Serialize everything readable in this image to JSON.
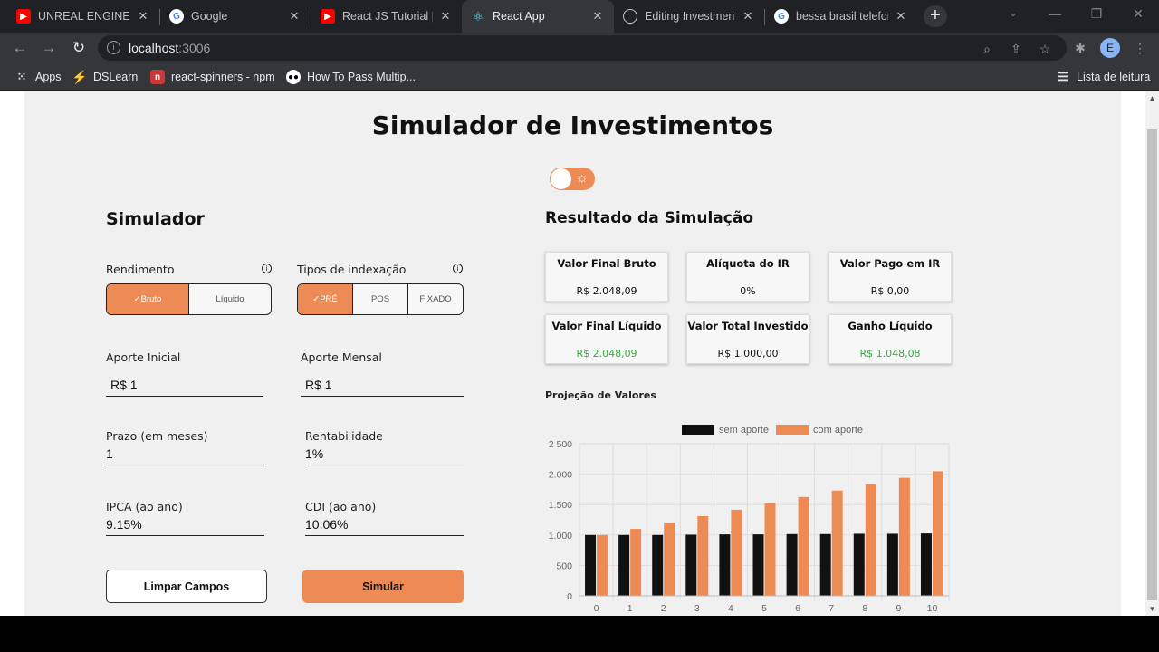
{
  "browser": {
    "tabs": [
      {
        "label": "UNREAL ENGINE (d",
        "icon": "youtube-icon"
      },
      {
        "label": "Google",
        "icon": "google-icon"
      },
      {
        "label": "React JS Tutorial | (",
        "icon": "youtube-icon"
      },
      {
        "label": "React App",
        "icon": "react-icon",
        "active": true
      },
      {
        "label": "Editing Investment",
        "icon": "github-icon"
      },
      {
        "label": "bessa brasil telefon",
        "icon": "google-icon"
      }
    ],
    "url_host": "localhost",
    "url_port": ":3006",
    "avatar_letter": "E",
    "bookmarks": [
      {
        "label": "Apps"
      },
      {
        "label": "DSLearn"
      },
      {
        "label": "react-spinners - npm"
      },
      {
        "label": "How To Pass Multip..."
      }
    ],
    "reading_list": "Lista de leitura"
  },
  "page": {
    "title": "Simulador de Investimentos",
    "accent": "#ee8b55",
    "simulator": {
      "title": "Simulador",
      "rendimento_label": "Rendimento",
      "rendimento_options": [
        "✓Bruto",
        "Líquido"
      ],
      "indexacao_label": "Tipos de indexação",
      "indexacao_options": [
        "✓PRÉ",
        "POS",
        "FIXADO"
      ],
      "aporte_inicial_label": "Aporte Inicial",
      "aporte_inicial_value": "R$ 1",
      "aporte_mensal_label": "Aporte Mensal",
      "aporte_mensal_value": "R$ 1",
      "prazo_label": "Prazo (em meses)",
      "prazo_value": "1",
      "rentabilidade_label": "Rentabilidade",
      "rentabilidade_value": "1%",
      "ipca_label": "IPCA (ao ano)",
      "ipca_value": "9.15%",
      "cdi_label": "CDI (ao ano)",
      "cdi_value": "10.06%",
      "clear_label": "Limpar Campos",
      "simulate_label": "Simular"
    },
    "result": {
      "title": "Resultado da Simulação",
      "cards": [
        {
          "title": "Valor Final Bruto",
          "value": "R$ 2.048,09",
          "green": false
        },
        {
          "title": "Alíquota do IR",
          "value": "0%",
          "green": false
        },
        {
          "title": "Valor Pago em IR",
          "value": "R$ 0,00",
          "green": false
        },
        {
          "title": "Valor Final Líquido",
          "value": "R$ 2.048,09",
          "green": true
        },
        {
          "title": "Valor Total Investido",
          "value": "R$ 1.000,00",
          "green": false
        },
        {
          "title": "Ganho Líquido",
          "value": "R$ 1.048,08",
          "green": true
        }
      ],
      "chart_title": "Projeção de Valores"
    }
  },
  "chart_data": {
    "type": "bar",
    "categories": [
      "0",
      "1",
      "2",
      "3",
      "4",
      "5",
      "6",
      "7",
      "8",
      "9",
      "10"
    ],
    "series": [
      {
        "name": "sem aporte",
        "color": "#111111",
        "values": [
          1000,
          1000,
          1000,
          1005,
          1010,
          1010,
          1015,
          1015,
          1020,
          1020,
          1025
        ]
      },
      {
        "name": "com aporte",
        "color": "#ee8b55",
        "values": [
          1000,
          1100,
          1205,
          1310,
          1415,
          1520,
          1625,
          1730,
          1835,
          1940,
          2048
        ]
      }
    ],
    "ylim": [
      0,
      2500
    ],
    "yticks": [
      "0",
      "500",
      "1.000",
      "1.500",
      "2.000",
      "2 500"
    ],
    "ytick_values": [
      0,
      500,
      1000,
      1500,
      2000,
      2500
    ],
    "grid": true,
    "legend": "top"
  }
}
